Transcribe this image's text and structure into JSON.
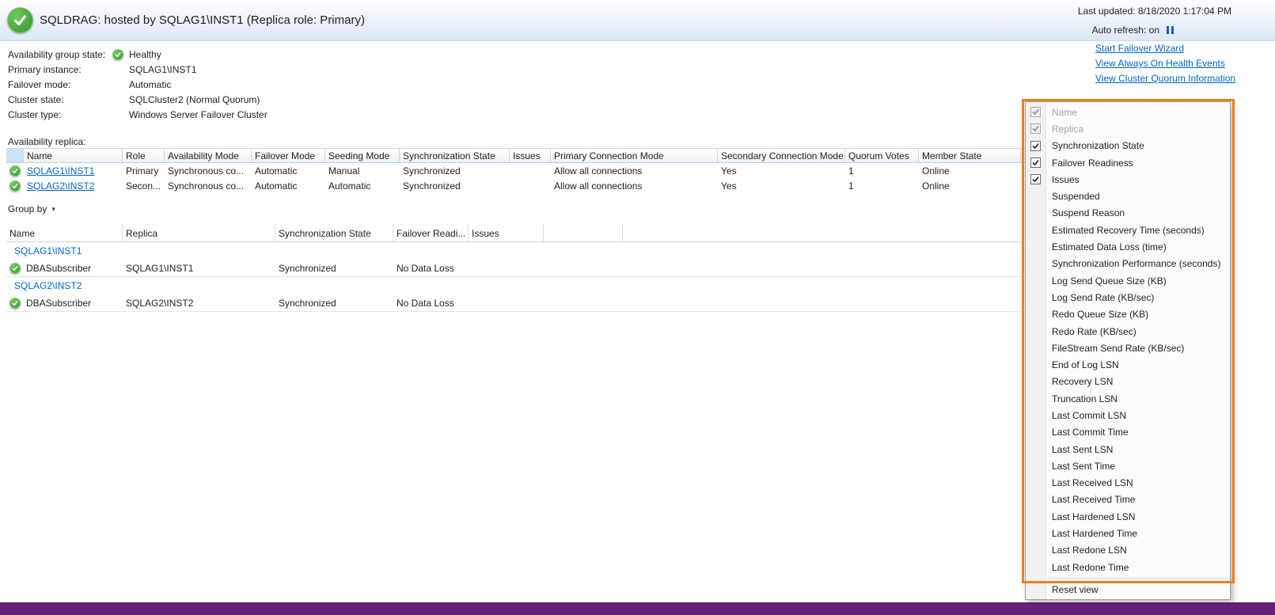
{
  "header": {
    "title": "SQLDRAG: hosted by SQLAG1\\INST1 (Replica role: Primary)",
    "last_updated": "Last updated: 8/18/2020 1:17:04 PM",
    "auto_refresh": "Auto refresh: on",
    "status_icon": "check-circle-icon",
    "pause_icon": "pause-icon"
  },
  "summary": {
    "rows": [
      {
        "label": "Availability group state:",
        "value": "Healthy",
        "icon": true
      },
      {
        "label": "Primary instance:",
        "value": "SQLAG1\\INST1"
      },
      {
        "label": "Failover mode:",
        "value": "Automatic"
      },
      {
        "label": "Cluster state:",
        "value": "SQLCluster2 (Normal Quorum)"
      },
      {
        "label": "Cluster type:",
        "value": "Windows Server Failover Cluster"
      }
    ]
  },
  "actions": [
    "Start Failover Wizard",
    "View Always On Health Events",
    "View Cluster Quorum Information"
  ],
  "replica_section": {
    "label": "Availability replica:",
    "columns": [
      "Name",
      "Role",
      "Availability Mode",
      "Failover Mode",
      "Seeding Mode",
      "Synchronization State",
      "Issues",
      "Primary Connection Mode",
      "Secondary Connection Mode",
      "Quorum Votes",
      "Member State"
    ],
    "rows": [
      {
        "name": "SQLAG1\\INST1",
        "cells": [
          "Primary",
          "Synchronous co...",
          "Automatic",
          "Manual",
          "Synchronized",
          "",
          "Allow all connections",
          "Yes",
          "1",
          "Online"
        ]
      },
      {
        "name": "SQLAG2\\INST2",
        "cells": [
          "Secon...",
          "Synchronous co...",
          "Automatic",
          "Automatic",
          "Synchronized",
          "",
          "Allow all connections",
          "Yes",
          "1",
          "Online"
        ]
      }
    ]
  },
  "group_by_label": "Group by",
  "db_section": {
    "columns": [
      "Name",
      "Replica",
      "Synchronization State",
      "Failover Readi...",
      "Issues"
    ],
    "groups": [
      {
        "group": "SQLAG1\\INST1",
        "rows": [
          {
            "name": "DBASubscriber",
            "replica": "SQLAG1\\INST1",
            "sync": "Synchronized",
            "failover": "No Data Loss",
            "issues": ""
          }
        ]
      },
      {
        "group": "SQLAG2\\INST2",
        "rows": [
          {
            "name": "DBASubscriber",
            "replica": "SQLAG2\\INST2",
            "sync": "Synchronized",
            "failover": "No Data Loss",
            "issues": ""
          }
        ]
      }
    ]
  },
  "context_menu": {
    "items": [
      {
        "label": "Name",
        "checked": true,
        "disabled": true
      },
      {
        "label": "Replica",
        "checked": true,
        "disabled": true
      },
      {
        "label": "Synchronization State",
        "checked": true,
        "disabled": false
      },
      {
        "label": "Failover Readiness",
        "checked": true,
        "disabled": false
      },
      {
        "label": "Issues",
        "checked": true,
        "disabled": false
      },
      {
        "label": "Suspended",
        "checked": false,
        "disabled": false
      },
      {
        "label": "Suspend Reason",
        "checked": false,
        "disabled": false
      },
      {
        "label": "Estimated Recovery Time (seconds)",
        "checked": false,
        "disabled": false
      },
      {
        "label": "Estimated Data Loss (time)",
        "checked": false,
        "disabled": false
      },
      {
        "label": "Synchronization Performance (seconds)",
        "checked": false,
        "disabled": false
      },
      {
        "label": "Log Send Queue Size (KB)",
        "checked": false,
        "disabled": false
      },
      {
        "label": "Log Send Rate (KB/sec)",
        "checked": false,
        "disabled": false
      },
      {
        "label": "Redo Queue Size (KB)",
        "checked": false,
        "disabled": false
      },
      {
        "label": "Redo Rate (KB/sec)",
        "checked": false,
        "disabled": false
      },
      {
        "label": "FileStream Send Rate (KB/sec)",
        "checked": false,
        "disabled": false
      },
      {
        "label": "End of Log LSN",
        "checked": false,
        "disabled": false
      },
      {
        "label": "Recovery LSN",
        "checked": false,
        "disabled": false
      },
      {
        "label": "Truncation LSN",
        "checked": false,
        "disabled": false
      },
      {
        "label": "Last Commit LSN",
        "checked": false,
        "disabled": false
      },
      {
        "label": "Last Commit Time",
        "checked": false,
        "disabled": false
      },
      {
        "label": "Last Sent LSN",
        "checked": false,
        "disabled": false
      },
      {
        "label": "Last Sent Time",
        "checked": false,
        "disabled": false
      },
      {
        "label": "Last Received LSN",
        "checked": false,
        "disabled": false
      },
      {
        "label": "Last Received Time",
        "checked": false,
        "disabled": false
      },
      {
        "label": "Last Hardened LSN",
        "checked": false,
        "disabled": false
      },
      {
        "label": "Last Hardened Time",
        "checked": false,
        "disabled": false
      },
      {
        "label": "Last Redone LSN",
        "checked": false,
        "disabled": false
      },
      {
        "label": "Last Redone Time",
        "checked": false,
        "disabled": false
      }
    ],
    "footer": "Reset view"
  },
  "colors": {
    "healthy_green": "#39a935",
    "link_blue": "#0066cc",
    "annotation_orange": "#e8821e",
    "statusbar_purple": "#68217a",
    "pause_blue": "#1360b8",
    "header_first_cell_blue": "#cbe3f7"
  },
  "icons": {
    "status": "check-circle-icon",
    "pause": "pause-icon",
    "group_by_caret": "chevron-down-icon"
  }
}
